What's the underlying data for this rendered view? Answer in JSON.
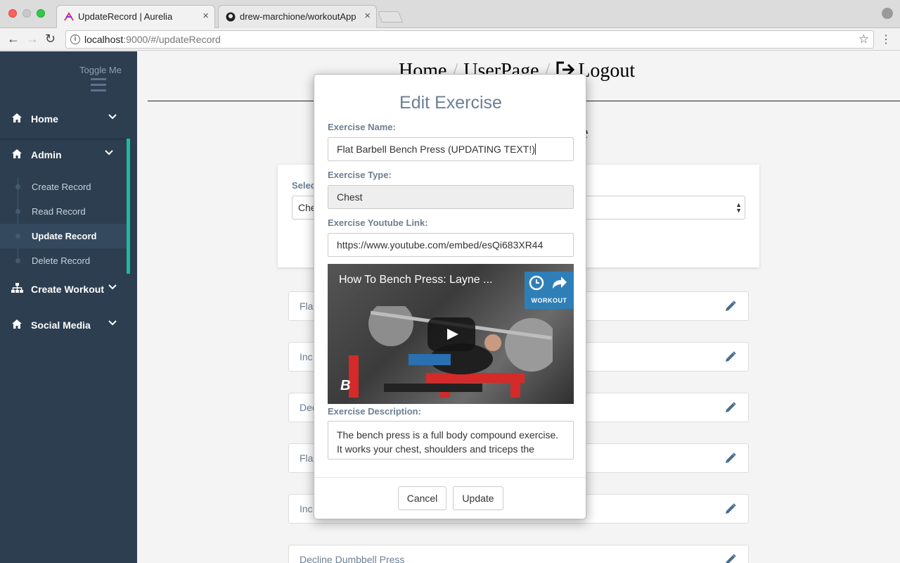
{
  "browser": {
    "tabs": [
      {
        "title": "UpdateRecord | Aurelia",
        "close": "×",
        "icon": "aurelia-icon"
      },
      {
        "title": "drew-marchione/workoutApp",
        "close": "×",
        "icon": "github-icon"
      }
    ],
    "url_host": "localhost",
    "url_path": ":9000/#/updateRecord"
  },
  "sidebar": {
    "toggle_label": "Toggle Me",
    "items": [
      {
        "label": "Home",
        "icon": "home-icon"
      },
      {
        "label": "Admin",
        "icon": "home-icon"
      },
      {
        "label": "Create Workout",
        "icon": "sitemap-icon"
      },
      {
        "label": "Social Media",
        "icon": "home-icon"
      }
    ],
    "admin_sub": [
      {
        "label": "Create Record"
      },
      {
        "label": "Read Record"
      },
      {
        "label": "Update Record",
        "active": true
      },
      {
        "label": "Delete Record"
      }
    ]
  },
  "topnav": {
    "home": "Home",
    "userpage": "UserPage",
    "logout": "Logout",
    "sep": "/"
  },
  "page": {
    "heading_visible": "e",
    "select_label_visible": "Selec",
    "select_value_visible": "Che"
  },
  "exercise_rows": [
    {
      "name": "Fla"
    },
    {
      "name": "Inc"
    },
    {
      "name": "Dec"
    },
    {
      "name": "Fla"
    },
    {
      "name": "Inc"
    },
    {
      "name": "Decline Dumbbell Press"
    }
  ],
  "modal": {
    "title": "Edit Exercise",
    "name_label": "Exercise Name:",
    "name_value": "Flat Barbell Bench Press (UPDATING TEXT!)",
    "type_label": "Exercise Type:",
    "type_value": "Chest",
    "link_label": "Exercise Youtube Link:",
    "link_value": "https://www.youtube.com/embed/esQi683XR44",
    "video_title": "How To Bench Press: Layne ...",
    "video_badge": "WORKOUT",
    "video_logo": "B",
    "desc_label": "Exercise Description:",
    "desc_value": "The bench press is a full body compound exercise. It works your chest, shoulders and triceps the",
    "cancel_label": "Cancel",
    "update_label": "Update"
  },
  "colors": {
    "sidebar_bg": "#2c3e50",
    "accent": "#1abc9c",
    "label_slate": "#6c7f93"
  }
}
